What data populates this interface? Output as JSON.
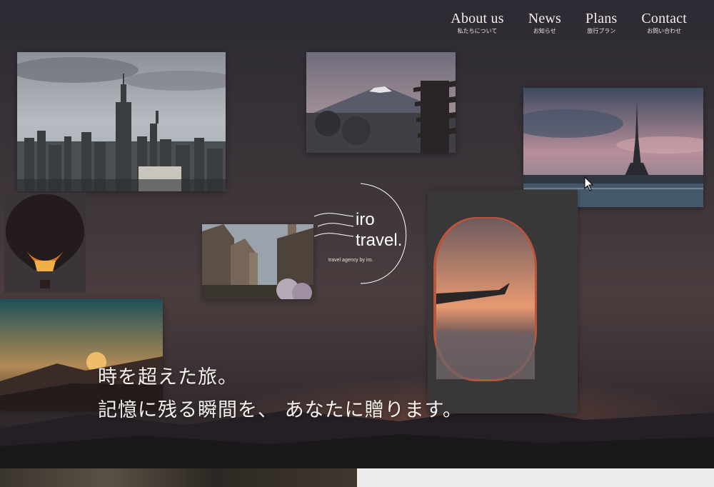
{
  "nav": [
    {
      "en": "About us",
      "jp": "私たちについて"
    },
    {
      "en": "News",
      "jp": "お知らせ"
    },
    {
      "en": "Plans",
      "jp": "旅行プラン"
    },
    {
      "en": "Contact",
      "jp": "お問い合わせ"
    }
  ],
  "logo": {
    "line1": "iro",
    "line2": "travel.",
    "tagline": "travel agency by iro."
  },
  "hero": {
    "line1": "時を超えた旅。",
    "line2": "記憶に残る瞬間を、 あなたに贈ります。"
  },
  "photos": [
    {
      "name": "new-york-skyline-photo"
    },
    {
      "name": "mount-fuji-pagoda-photo"
    },
    {
      "name": "eiffel-tower-photo"
    },
    {
      "name": "hot-air-balloon-photo"
    },
    {
      "name": "old-town-street-photo"
    },
    {
      "name": "airplane-window-photo"
    },
    {
      "name": "mountain-sunrise-photo"
    }
  ],
  "colors": {
    "background": "#3b3439",
    "text": "#ffffff",
    "panel": "#ececec"
  }
}
